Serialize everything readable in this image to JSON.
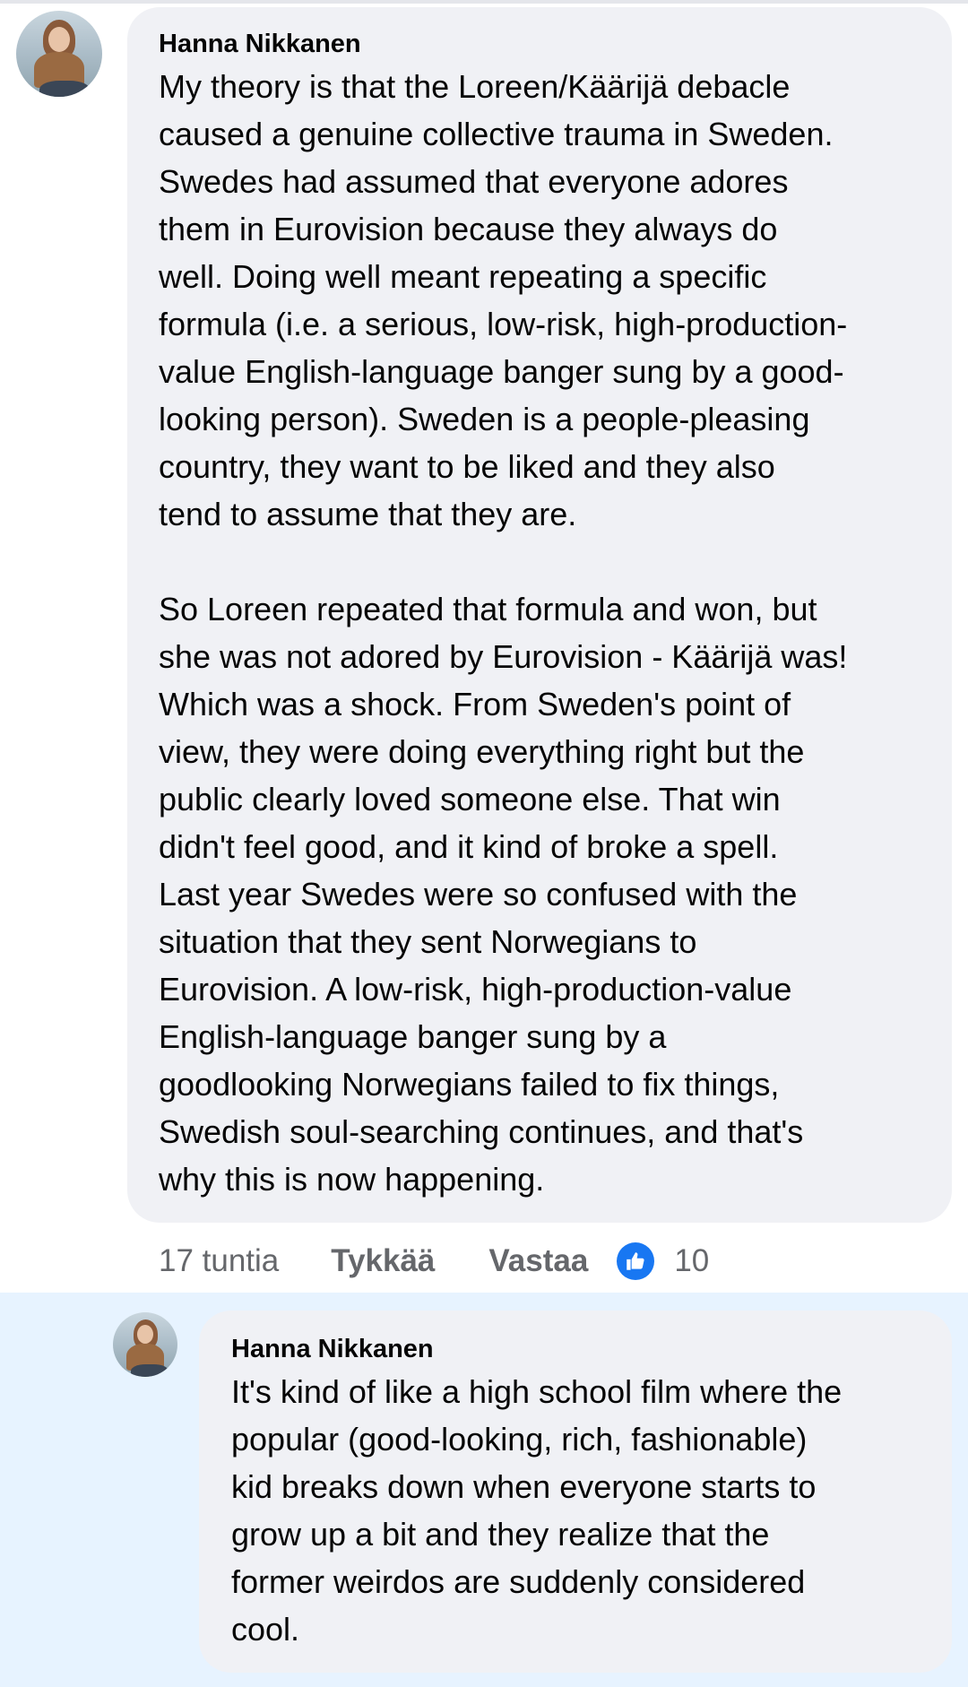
{
  "comment": {
    "author": "Hanna Nikkanen",
    "lines_p1": [
      "My theory is that the Loreen/Käärijä debacle",
      "caused a genuine collective trauma in Sweden.",
      "Swedes had assumed that everyone adores",
      "them in Eurovision because they always do",
      "well. Doing well meant repeating a specific",
      "formula (i.e. a serious, low-risk, high-production-",
      "value English-language banger sung by a good-",
      "looking person). Sweden is a people-pleasing",
      "country, they want to be liked and they also",
      "tend to assume that they are."
    ],
    "lines_p2": [
      "So Loreen repeated that formula and won, but",
      "she was not adored by Eurovision - Käärijä was!",
      "Which was a shock. From Sweden's point of",
      "view, they were doing everything right but the",
      "public clearly loved someone else. That win",
      "didn't feel good, and it kind of broke a spell.",
      "Last year Swedes were so confused with the",
      "situation that they sent Norwegians to",
      "Eurovision. A low-risk, high-production-value",
      "English-language banger sung by a",
      "goodlooking Norwegians failed to fix things,",
      "Swedish soul-searching continues, and that's",
      "why this is now happening."
    ],
    "timestamp": "17 tuntia",
    "like_label": "Tykkää",
    "reply_label": "Vastaa",
    "reaction_count": "10",
    "reaction_icon": "thumbs-up-icon",
    "reaction_color": "#1877f2"
  },
  "reply": {
    "author": "Hanna Nikkanen",
    "lines": [
      "It's kind of like a high school film where the",
      "popular (good-looking, rich, fashionable)",
      "kid breaks down when everyone starts to",
      "grow up a bit and they realize that the",
      "former weirdos are suddenly considered",
      "cool."
    ],
    "highlight_color": "#e7f3ff"
  },
  "colors": {
    "bubble": "#f0f1f5",
    "meta_text": "#65676b"
  }
}
